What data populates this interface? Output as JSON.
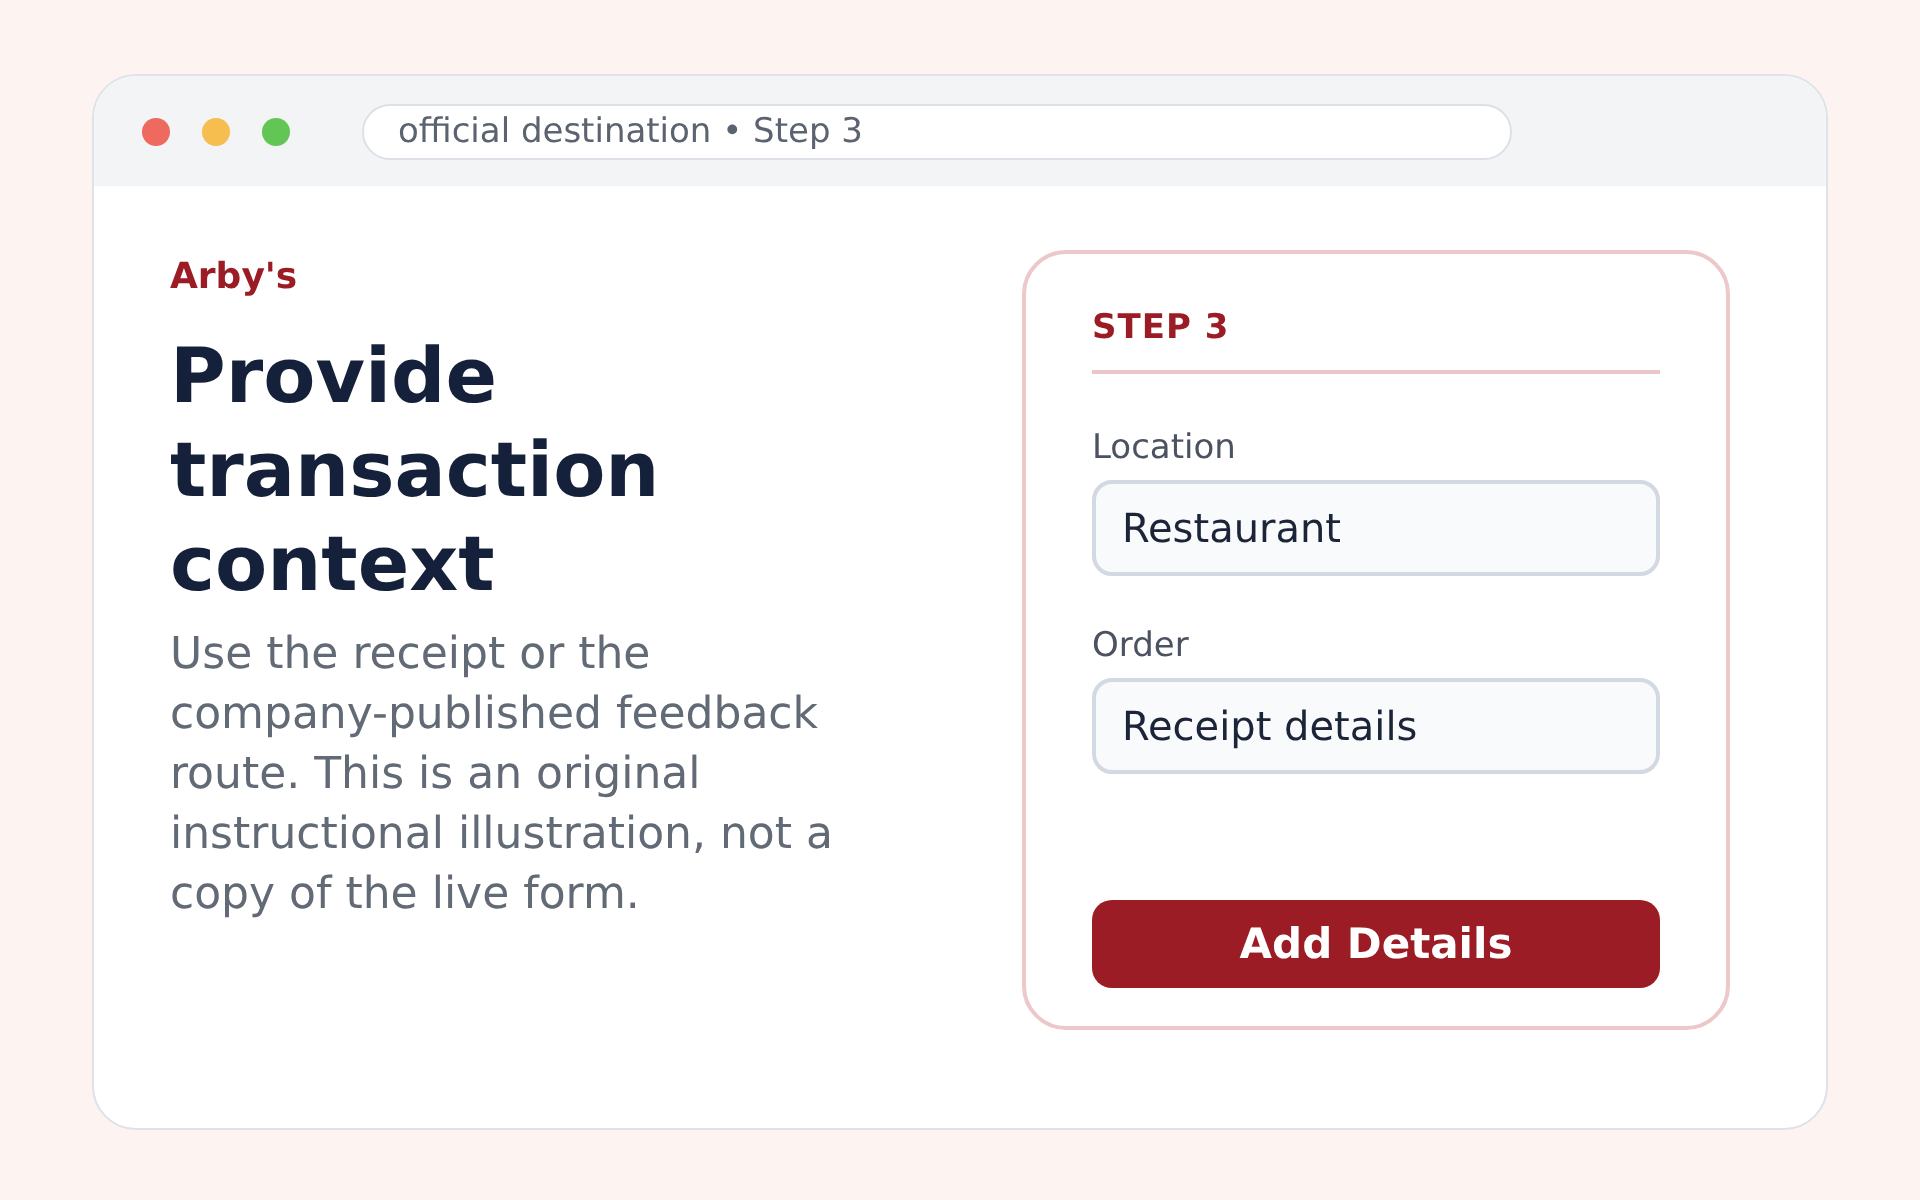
{
  "browser": {
    "address": "official destination • Step 3"
  },
  "intro": {
    "brand": "Arby's",
    "heading": "Provide transaction context",
    "description": "Use the receipt or the company-published feedback route. This is an original instructional illustration, not a copy of the live form."
  },
  "form": {
    "step": "STEP 3",
    "fields": [
      {
        "label": "Location",
        "value": "Restaurant"
      },
      {
        "label": "Order",
        "value": "Receipt details"
      }
    ],
    "submit": "Add Details"
  }
}
